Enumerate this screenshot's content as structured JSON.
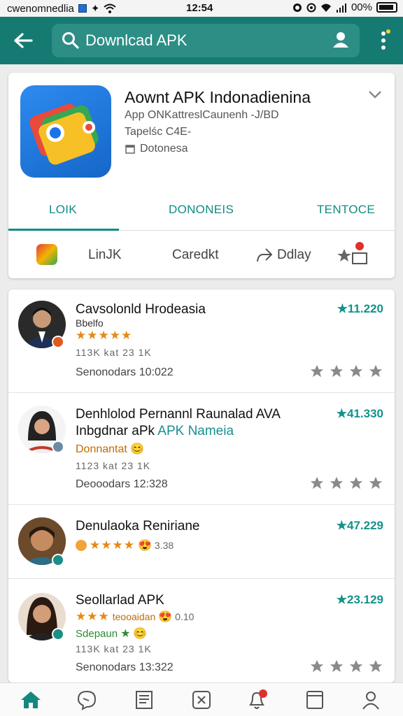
{
  "status_bar": {
    "left_text": "cwenomnedlia",
    "time": "12:54",
    "battery": "00%"
  },
  "search": {
    "placeholder": "Downlcad APK"
  },
  "app": {
    "title": "Aownt APK Indonadienina",
    "subtitle1": "App ONKattreslCaunenh -J/BD",
    "subtitle2": "Tapelśc  C4E-",
    "subtitle3": "Dotonesa"
  },
  "tabs": [
    {
      "label": "LOIK"
    },
    {
      "label": "DONONEIS"
    },
    {
      "label": "TENTOCE"
    }
  ],
  "actions": [
    {
      "label": "LinJK"
    },
    {
      "label": "Caredkt"
    },
    {
      "label": "Ddlay"
    }
  ],
  "results": [
    {
      "name": "Cavsolonld Hrodeasia",
      "sub": "Bbelfo",
      "meta": "113K  kat 23  1K",
      "foot": "Senonodars   10:022",
      "score": "★11.220"
    },
    {
      "name": "Denhlolod Pernannl  Raunalad AVA",
      "name2_a": "Inbgdnar aPk",
      "name2_b": "APK Nameia",
      "sub": "Donnantat",
      "meta": "1123  kat 23  1K",
      "foot": "Deooodars   12:328",
      "score": "★41.330"
    },
    {
      "name": "Denulaoka Reniriane",
      "rating_text": "3.38",
      "score": "★47.229"
    },
    {
      "name": "Seollarlad APK",
      "sub": "teooaidan",
      "sub_value": "0.10",
      "sub2": "Sdepaun",
      "meta": "113K  kat 23  1K",
      "foot": "Senonodars   13:322",
      "score": "★23.129"
    }
  ],
  "colors": {
    "app_bar": "#157a72",
    "accent": "#0f8c82",
    "star_orange": "#e38a16"
  },
  "icons": [
    "back-arrow-icon",
    "search-icon",
    "account-icon",
    "more-vert-icon",
    "chevron-down-icon",
    "calendar-icon",
    "share-icon",
    "star-badge-icon",
    "home-icon",
    "chat-icon",
    "document-icon",
    "close-box-icon",
    "bell-icon",
    "tablet-icon",
    "profile-icon"
  ]
}
